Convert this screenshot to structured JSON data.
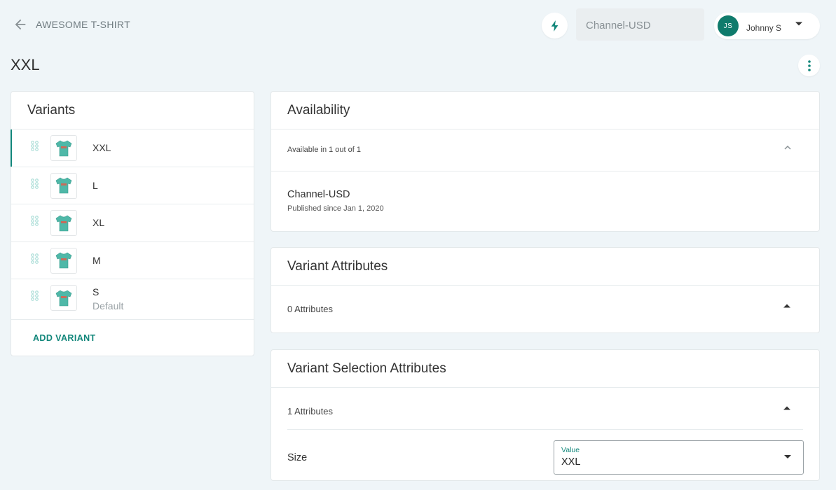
{
  "header": {
    "back_label": "AWESOME T-SHIRT",
    "channel": "Channel-USD",
    "user": {
      "initials": "JS",
      "name": "Johnny S"
    }
  },
  "page": {
    "title": "XXL"
  },
  "variants": {
    "title": "Variants",
    "items": [
      {
        "name": "XXL",
        "sub": "",
        "active": true
      },
      {
        "name": "L",
        "sub": ""
      },
      {
        "name": "XL",
        "sub": ""
      },
      {
        "name": "M",
        "sub": ""
      },
      {
        "name": "S",
        "sub": "Default"
      }
    ],
    "add_label": "ADD VARIANT"
  },
  "availability": {
    "title": "Availability",
    "summary": "Available in 1 out of 1",
    "channel_name": "Channel-USD",
    "channel_status": "Published since Jan 1, 2020"
  },
  "variant_attributes": {
    "title": "Variant Attributes",
    "count": "0 Attributes"
  },
  "variant_selection_attributes": {
    "title": "Variant Selection Attributes",
    "count": "1 Attributes",
    "attribute_label": "Size",
    "value_legend": "Value",
    "value": "XXL"
  },
  "colors": {
    "accent": "#11867a",
    "avatar": "#0f7b6c",
    "background": "#eff5f8"
  }
}
